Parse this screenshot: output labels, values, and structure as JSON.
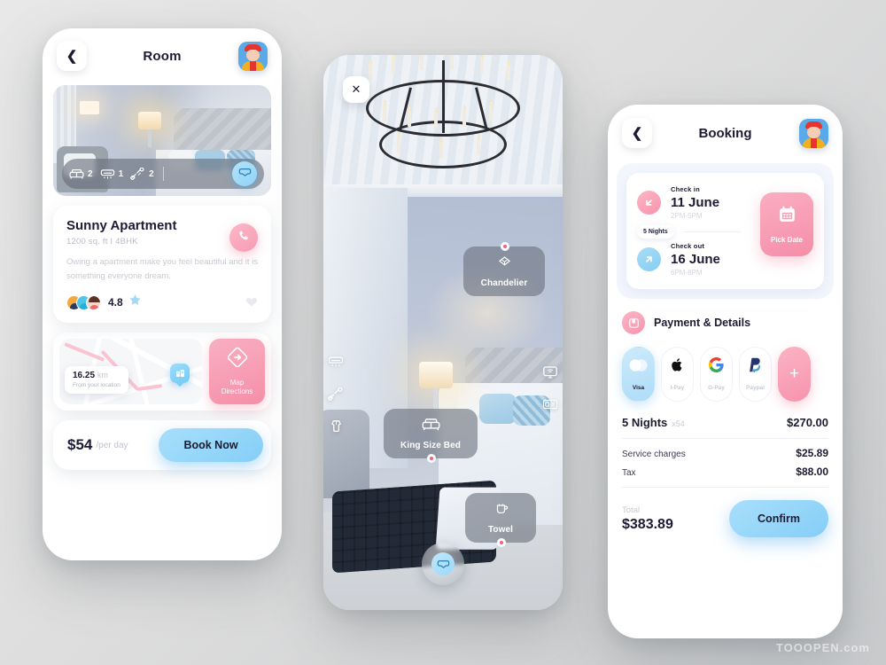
{
  "colors": {
    "accent_pink": "#f794ae",
    "accent_blue": "#85cef7",
    "text_dark": "#1c1b33",
    "text_muted": "#c6cad3",
    "background": "#dedede"
  },
  "room_screen": {
    "back_icon": "chevron-left-icon",
    "title": "Room",
    "avatar_name": "user-avatar",
    "amenities": [
      {
        "icon": "bed-icon",
        "count": "2"
      },
      {
        "icon": "air-conditioner-icon",
        "count": "1"
      },
      {
        "icon": "telephone-icon",
        "count": "2"
      }
    ],
    "vr_icon": "vr-headset-icon",
    "apartment": {
      "name": "Sunny Apartment",
      "specs": "1200 sq. ft I 4BHK",
      "description": "Owing a apartment make you feel beautiful and it is something everyone dream.",
      "rating": "4.8",
      "star_icon": "star-icon",
      "call_icon": "phone-call-icon",
      "favorite_icon": "heart-icon"
    },
    "map": {
      "distance_value": "16.25",
      "distance_unit": "km",
      "distance_sub": "From your location",
      "pin_icon": "building-pin-icon",
      "directions_icon": "direction-arrow-icon",
      "directions_label_line1": "Map",
      "directions_label_line2": "Directions"
    },
    "booking_bar": {
      "price": "$54",
      "price_unit": "/per day",
      "book_label": "Book Now"
    }
  },
  "ar_screen": {
    "close_icon": "close-icon",
    "tags": [
      {
        "label": "Chandelier",
        "icon": "chandelier-icon"
      },
      {
        "label": "King Size Bed",
        "icon": "bed-icon"
      },
      {
        "label": "Towel",
        "icon": "towel-icon"
      }
    ],
    "left_rail": [
      {
        "icon": "air-conditioner-icon"
      },
      {
        "icon": "telephone-icon"
      },
      {
        "icon": "clothes-hanger-icon"
      }
    ],
    "right_rail": [
      {
        "icon": "tv-wifi-icon"
      },
      {
        "icon": "safe-box-icon"
      }
    ],
    "fab_icon": "vr-headset-icon"
  },
  "booking_screen": {
    "back_icon": "chevron-left-icon",
    "title": "Booking",
    "avatar_name": "user-avatar",
    "dates": {
      "checkin_label": "Check in",
      "checkin_date": "11 June",
      "checkin_time": "2PM-5PM",
      "checkin_icon": "arrow-down-left-icon",
      "nights_badge": "5 Nights",
      "checkout_label": "Check out",
      "checkout_date": "16 June",
      "checkout_time": "6PM-8PM",
      "checkout_icon": "arrow-up-right-icon",
      "pick_date_label": "Pick Date",
      "pick_date_icon": "calendar-icon"
    },
    "payment": {
      "section_icon": "wallet-icon",
      "section_title": "Payment & Details",
      "methods": [
        {
          "label": "Visa",
          "icon": "mastercard-circles-icon",
          "selected": true
        },
        {
          "label": "I-Pay",
          "icon": "apple-icon",
          "selected": false
        },
        {
          "label": "G-Pay",
          "icon": "google-g-icon",
          "selected": false
        },
        {
          "label": "Paypal",
          "icon": "paypal-icon",
          "selected": false
        }
      ],
      "add_label": "+"
    },
    "bill": {
      "main_label": "5 Nights",
      "main_multiplier": "x54",
      "main_amount": "$270.00",
      "rows": [
        {
          "label": "Service charges",
          "amount": "$25.89"
        },
        {
          "label": "Tax",
          "amount": "$88.00"
        }
      ],
      "total_label": "Total",
      "total_amount": "$383.89",
      "confirm_label": "Confirm"
    }
  },
  "watermark": "TOOOPEN.com"
}
